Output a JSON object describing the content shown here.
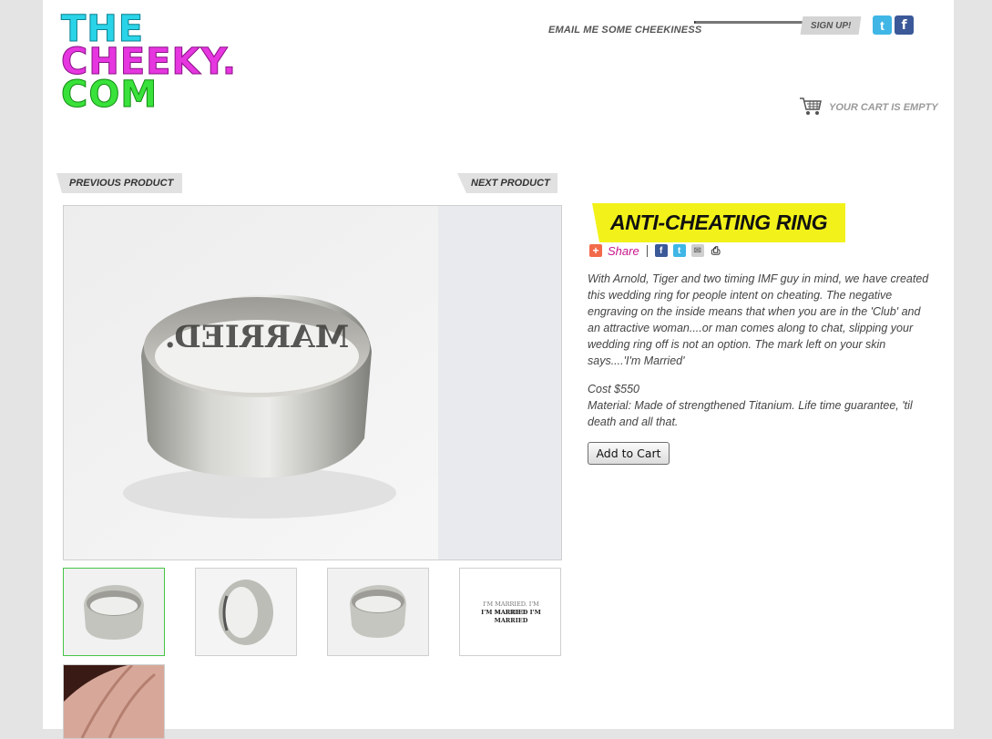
{
  "logo": {
    "line1": "THE",
    "line2": "CHEEKY.",
    "line3": "COM"
  },
  "header": {
    "email_label": "EMAIL ME SOME CHEEKINESS",
    "email_value": "",
    "signup_label": "SIGN UP!",
    "social": [
      {
        "name": "twitter-icon",
        "glyph": "t"
      },
      {
        "name": "facebook-icon",
        "glyph": "f"
      }
    ],
    "cart_text": "YOUR CART IS EMPTY"
  },
  "nav": {
    "prev_label": "PREVIOUS PRODUCT",
    "next_label": "NEXT PRODUCT"
  },
  "main_image": {
    "engraving": "MARRIED."
  },
  "thumbnails": [
    {
      "name": "thumb-ring-inside",
      "active": true
    },
    {
      "name": "thumb-ring-side",
      "active": false
    },
    {
      "name": "thumb-ring-inside-2",
      "active": false
    },
    {
      "name": "thumb-engraving-text",
      "active": false,
      "line1": "I'M MARRIED. I'M MARRIED.",
      "line2": "I'M MARRIED I'M MARRIED"
    },
    {
      "name": "thumb-hand",
      "active": false
    }
  ],
  "product": {
    "title": "ANTI-CHEATING RING",
    "share_label": "Share",
    "description": "With Arnold, Tiger and two timing IMF guy in mind, we have created this wedding ring for people intent on cheating. The negative engraving on the inside means that when you are in the 'Club' and an attractive woman....or man comes along to chat, slipping your wedding ring off is not an option. The mark left on your skin says....'I'm Married'",
    "cost": "Cost $550",
    "material": "Material: Made of strengthened Titanium. Life time guarantee, 'til death and all that.",
    "add_to_cart_label": "Add to Cart"
  },
  "colors": {
    "title_highlight": "#f2f21a",
    "share_accent": "#c8168a",
    "logo_cyan": "#2ad4e8",
    "logo_magenta": "#e636e0",
    "logo_green": "#39e23a"
  }
}
